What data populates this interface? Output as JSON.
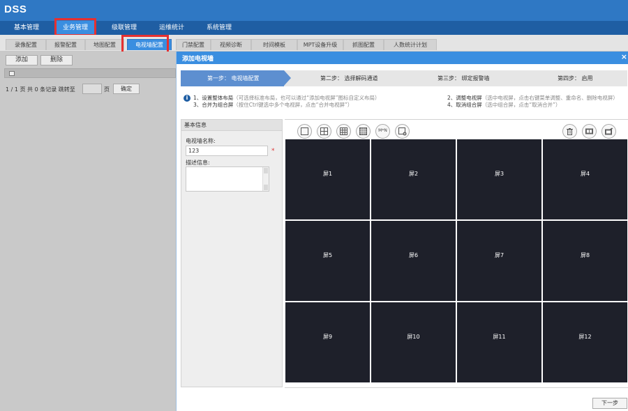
{
  "app": {
    "title": "DSS"
  },
  "main_nav": [
    {
      "label": "基本管理"
    },
    {
      "label": "业务管理"
    },
    {
      "label": "级联管理"
    },
    {
      "label": "运维统计"
    },
    {
      "label": "系统管理"
    }
  ],
  "sub_nav": [
    {
      "label": "录像配置"
    },
    {
      "label": "报警配置"
    },
    {
      "label": "地图配置"
    },
    {
      "label": "电视墙配置"
    },
    {
      "label": "门禁配置"
    },
    {
      "label": "视频诊断"
    },
    {
      "label": "时间模板"
    },
    {
      "label": "MPT设备升级"
    },
    {
      "label": "抓图配置"
    },
    {
      "label": "人数统计计划"
    }
  ],
  "left_panel": {
    "add_label": "添加",
    "delete_label": "删除",
    "pager_text": "1 / 1 页 共 0 条记录 跳转至",
    "page_unit": "页",
    "go_label": "确定"
  },
  "dialog": {
    "title": "添加电视墙",
    "close": "×",
    "steps": [
      {
        "label": "第一步： 电视墙配置"
      },
      {
        "label": "第二步： 选择解码通道"
      },
      {
        "label": "第三步： 绑定报警墙"
      },
      {
        "label": "第四步： 启用"
      }
    ],
    "tips": [
      {
        "main": "1、设置整体布局",
        "sub": "（可选择标准布局，也可以通过“添加电视屏”图标自定义布局）"
      },
      {
        "main": "3、合并为组合屏",
        "sub": "（按住Ctrl键选中多个电视屏，点击“合并电视屏”）"
      },
      {
        "main": "2、调整电视屏",
        "sub": "（选中电视屏，点击右键菜单调整、重命名、删除电视屏）"
      },
      {
        "main": "4、取消组合屏",
        "sub": "（选中组合屏，点击“取消合并”）"
      }
    ],
    "form": {
      "section_title": "基本信息",
      "name_label": "电视墙名称:",
      "name_value": "123",
      "required_mark": "*",
      "desc_label": "描述信息:"
    },
    "toolbar_layout_icons": [
      "layout-1x1-icon",
      "layout-2x2-icon",
      "layout-3x3-icon",
      "layout-4x4-icon",
      "layout-mxn-icon",
      "add-screen-icon"
    ],
    "toolbar_mxn_label": "M*N",
    "toolbar_action_icons": [
      "trash-icon",
      "merge-screen-icon",
      "unmerge-screen-icon"
    ],
    "screens": [
      "屏1",
      "屏2",
      "屏3",
      "屏4",
      "屏5",
      "屏6",
      "屏7",
      "屏8",
      "屏9",
      "屏10",
      "屏11",
      "屏12"
    ],
    "next_label": "下一步"
  },
  "colors": {
    "topbar": "#2f78c4",
    "main_nav": "#1f5ea3",
    "active_tab": "#3a8ee0",
    "step_active": "#5d8fd0",
    "screen_bg": "#1e202a",
    "highlight": "#e63030"
  }
}
